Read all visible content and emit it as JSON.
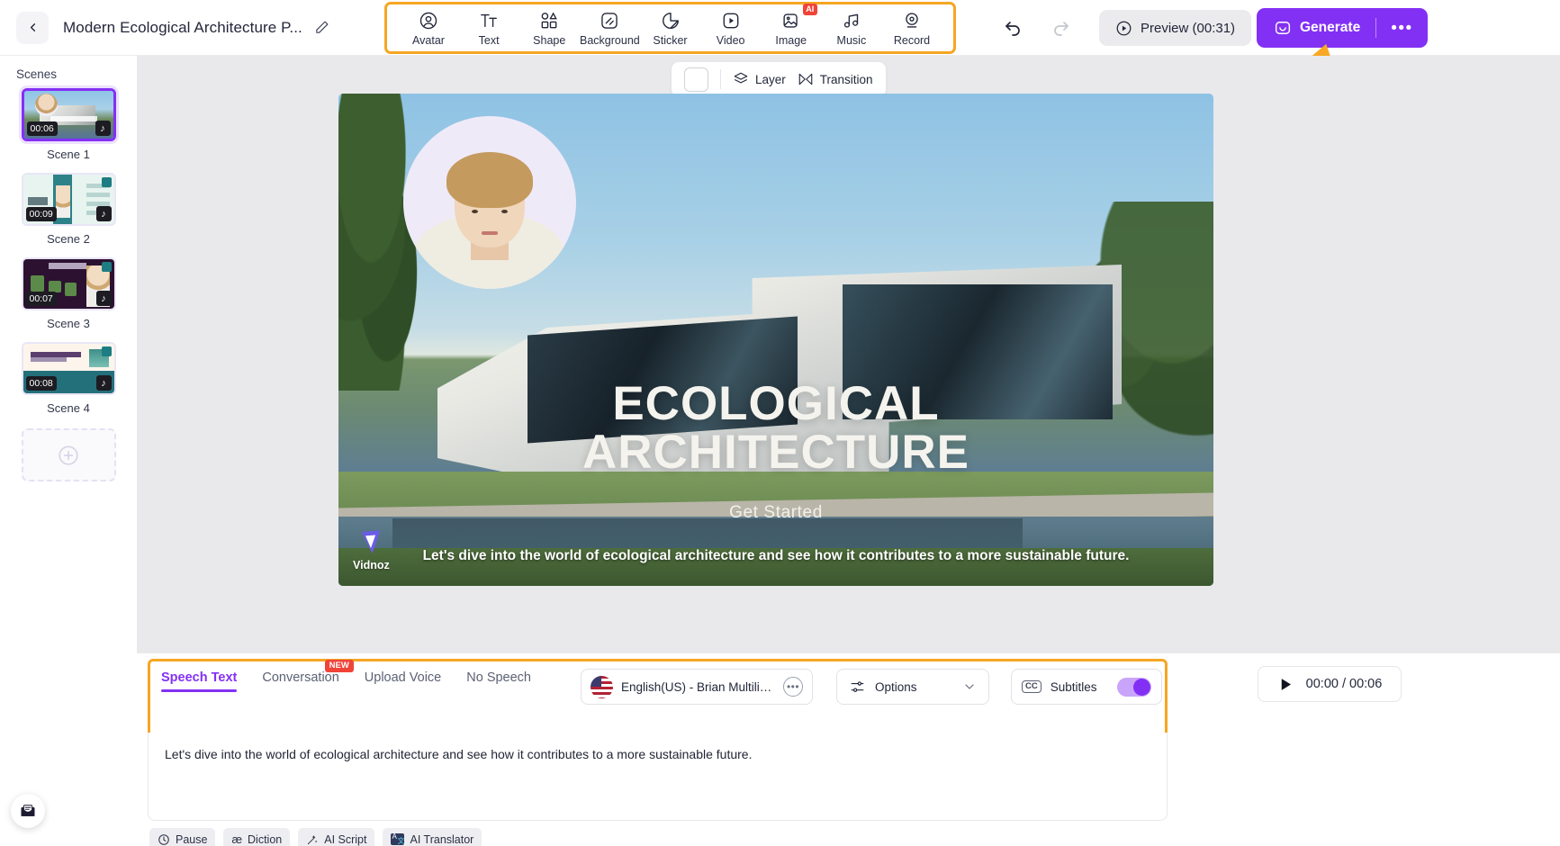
{
  "header": {
    "back_icon": "chevron-left-icon",
    "project_title": "Modern Ecological Architecture P...",
    "edit_icon": "pencil-icon",
    "tools": [
      {
        "label": "Avatar",
        "icon": "avatar-icon",
        "badge": ""
      },
      {
        "label": "Text",
        "icon": "text-icon",
        "badge": ""
      },
      {
        "label": "Shape",
        "icon": "shape-icon",
        "badge": ""
      },
      {
        "label": "Background",
        "icon": "background-icon",
        "badge": ""
      },
      {
        "label": "Sticker",
        "icon": "sticker-icon",
        "badge": ""
      },
      {
        "label": "Video",
        "icon": "video-icon",
        "badge": ""
      },
      {
        "label": "Image",
        "icon": "image-icon",
        "badge": "AI"
      },
      {
        "label": "Music",
        "icon": "music-icon",
        "badge": ""
      },
      {
        "label": "Record",
        "icon": "record-icon",
        "badge": ""
      }
    ],
    "undo_icon": "undo-icon",
    "redo_icon": "redo-icon",
    "preview_label": "Preview (00:31)",
    "preview_icon": "play-circle-icon",
    "generate_label": "Generate",
    "generate_icon": "generate-icon",
    "more_label": "•••",
    "accent_purple": "#8330f5",
    "highlight_orange": "#f5a623"
  },
  "sidebar": {
    "title": "Scenes",
    "scenes": [
      {
        "label": "Scene 1",
        "duration": "00:06",
        "active": true,
        "has_music": true
      },
      {
        "label": "Scene 2",
        "duration": "00:09",
        "active": false,
        "has_music": true
      },
      {
        "label": "Scene 3",
        "duration": "00:07",
        "active": false,
        "has_music": true
      },
      {
        "label": "Scene 4",
        "duration": "00:08",
        "active": false,
        "has_music": true
      }
    ],
    "add_scene_icon": "plus-circle-icon",
    "collapse_icon": "chevron-down-icon",
    "mail_fab_icon": "mail-icon"
  },
  "canvas": {
    "toolbar": {
      "color_swatch": "color-swatch",
      "layer_label": "Layer",
      "layer_icon": "layers-icon",
      "transition_label": "Transition",
      "transition_icon": "transition-icon"
    },
    "slide": {
      "title_line1": "ECOLOGICAL",
      "title_line2": "ARCHITECTURE",
      "subtitle": "Get Started",
      "caption": "Let's dive into the world of ecological architecture and see how it contributes to a more sustainable future.",
      "watermark": "Vidnoz"
    }
  },
  "bottom": {
    "tabs": [
      {
        "label": "Speech Text",
        "active": true,
        "badge": ""
      },
      {
        "label": "Conversation",
        "active": false,
        "badge": "NEW"
      },
      {
        "label": "Upload Voice",
        "active": false,
        "badge": ""
      },
      {
        "label": "No Speech",
        "active": false,
        "badge": ""
      }
    ],
    "voice": {
      "flag": "us-flag-icon",
      "name": "English(US) - Brian Multilingu...",
      "more_icon": "ellipsis-circle-icon"
    },
    "options": {
      "label": "Options",
      "icon": "sliders-icon",
      "chevron": "chevron-down-icon"
    },
    "subtitles": {
      "label": "Subtitles",
      "icon": "cc-icon",
      "enabled": true
    },
    "player": {
      "icon": "play-icon",
      "timecode": "00:00 / 00:06"
    },
    "script_text": "Let's dive into the world of ecological architecture and see how it contributes to a more sustainable future.",
    "actions": [
      {
        "label": "Pause",
        "icon": "clock-icon"
      },
      {
        "label": "Diction",
        "icon": "phonetic-icon"
      },
      {
        "label": "AI Script",
        "icon": "magic-wand-icon"
      },
      {
        "label": "AI Translator",
        "icon": "translate-icon"
      }
    ]
  }
}
